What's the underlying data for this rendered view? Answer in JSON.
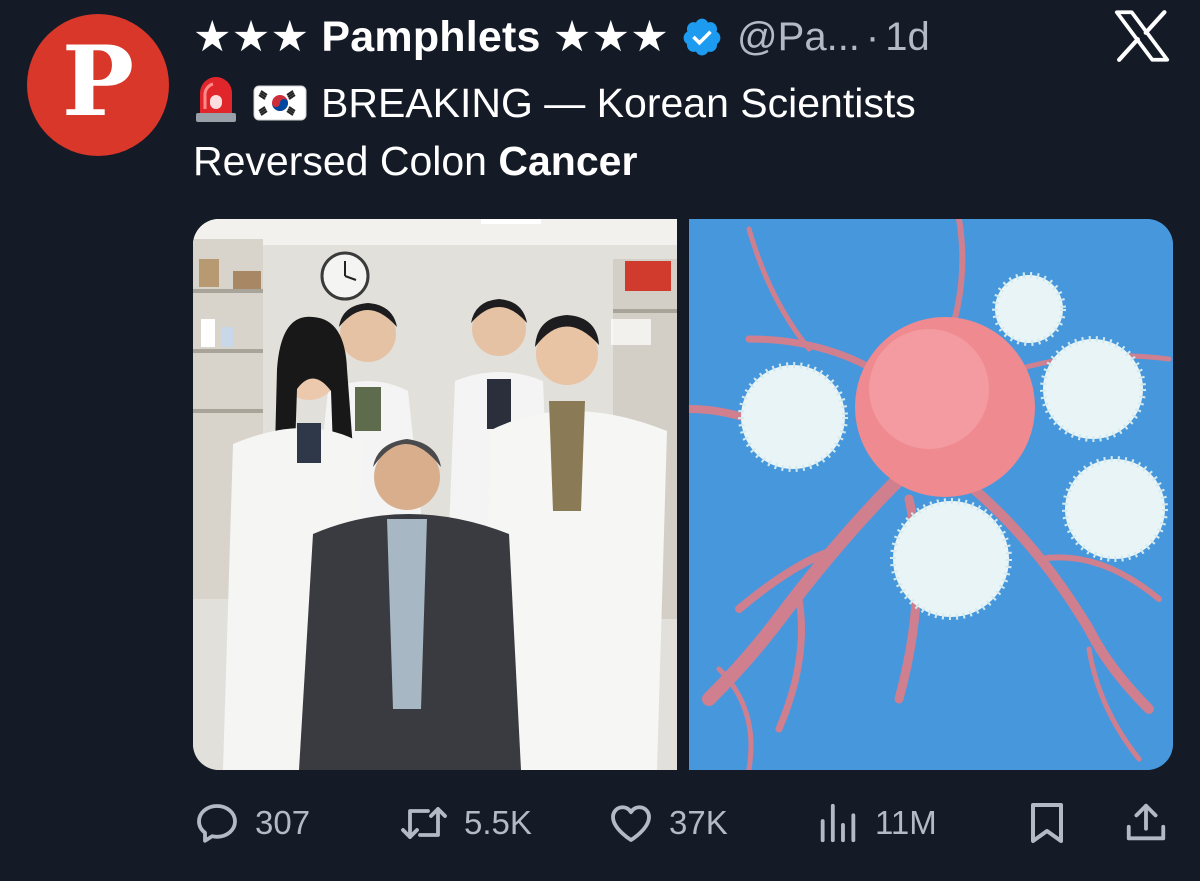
{
  "avatar": {
    "letter": "P",
    "color": "#d9372a"
  },
  "header": {
    "display_name": "★★★ Pamphlets ★★★",
    "verified_icon": "verified-badge-icon",
    "handle": "@Pa...",
    "separator": "·",
    "time": "1d",
    "platform_logo": "x-logo-icon"
  },
  "tweet": {
    "emoji_1": "rotating-light-emoji",
    "emoji_2": "south-korea-flag-emoji",
    "text_main": "BREAKING —  Korean Scientists Reversed Colon ",
    "text_bold": "Cancer"
  },
  "media": [
    {
      "kind": "photo",
      "subject": "five researchers in lab coats in a laboratory"
    },
    {
      "kind": "photo",
      "subject": "illustration of immune cells attacking a cancer cell"
    }
  ],
  "actions": {
    "reply": {
      "icon": "reply-icon",
      "count": "307"
    },
    "repost": {
      "icon": "repost-icon",
      "count": "5.5K"
    },
    "like": {
      "icon": "heart-icon",
      "count": "37K"
    },
    "views": {
      "icon": "views-icon",
      "count": "11M"
    },
    "bookmark": {
      "icon": "bookmark-icon"
    },
    "share": {
      "icon": "share-icon"
    }
  },
  "colors": {
    "background": "#151b26",
    "text": "#ffffff",
    "muted": "#b3bac5",
    "verified": "#1d9bf0"
  }
}
